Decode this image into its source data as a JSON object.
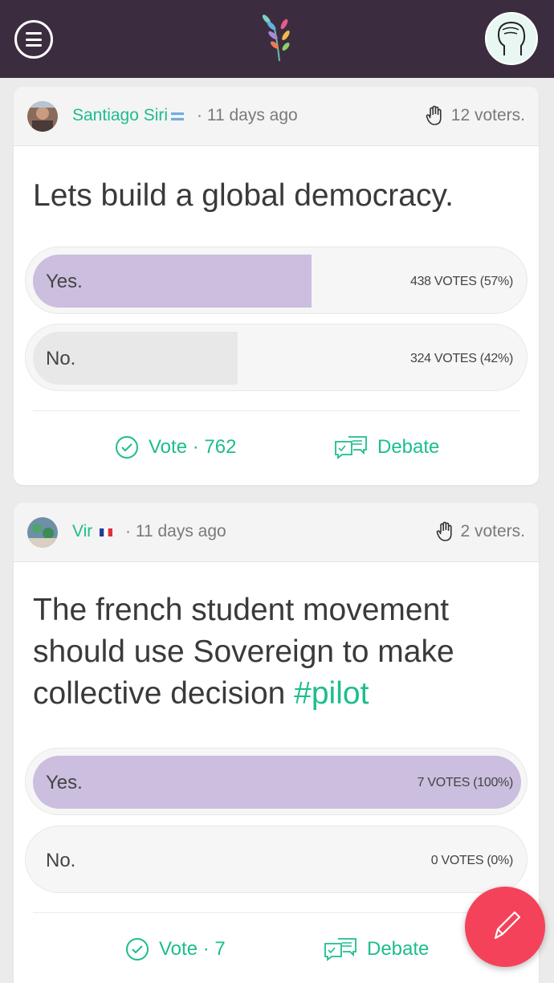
{
  "app": {
    "accent": "#1dbd8e",
    "topbar_color": "#3b2d3f",
    "fab_color": "#f5425b"
  },
  "icons": {
    "menu": "hamburger-menu-icon",
    "logo": "leaf-branch-logo",
    "profile": "head-silhouette-icon",
    "voters": "raised-hand-icon",
    "vote": "check-circle-icon",
    "debate": "chat-bubbles-icon",
    "compose": "pencil-icon"
  },
  "posts": [
    {
      "author": "Santiago Siri",
      "flag": "argentina-flag",
      "time": "· 11 days ago",
      "voters": "12 voters.",
      "title": "Lets build a global democracy.",
      "options": [
        {
          "label": "Yes.",
          "count": "438 VOTES (57%)",
          "share": 0.57,
          "color": "#cbbede"
        },
        {
          "label": "No.",
          "count": "324 VOTES (42%)",
          "share": 0.42,
          "color": "#e8e8e8"
        }
      ],
      "vote_label": "Vote · 762",
      "debate_label": "Debate"
    },
    {
      "author": "Vir",
      "flag": "france-flag",
      "time": "· 11 days ago",
      "voters": "2 voters.",
      "title": "The french student movement should use Sovereign to make collective decision ",
      "hashtag": "#pilot",
      "options": [
        {
          "label": "Yes.",
          "count": "7 VOTES (100%)",
          "share": 1.0,
          "color": "#cbbede"
        },
        {
          "label": "No.",
          "count": "0 VOTES (0%)",
          "share": 0.0,
          "color": "#e8e8e8"
        }
      ],
      "vote_label": "Vote · 7",
      "debate_label": "Debate"
    }
  ]
}
